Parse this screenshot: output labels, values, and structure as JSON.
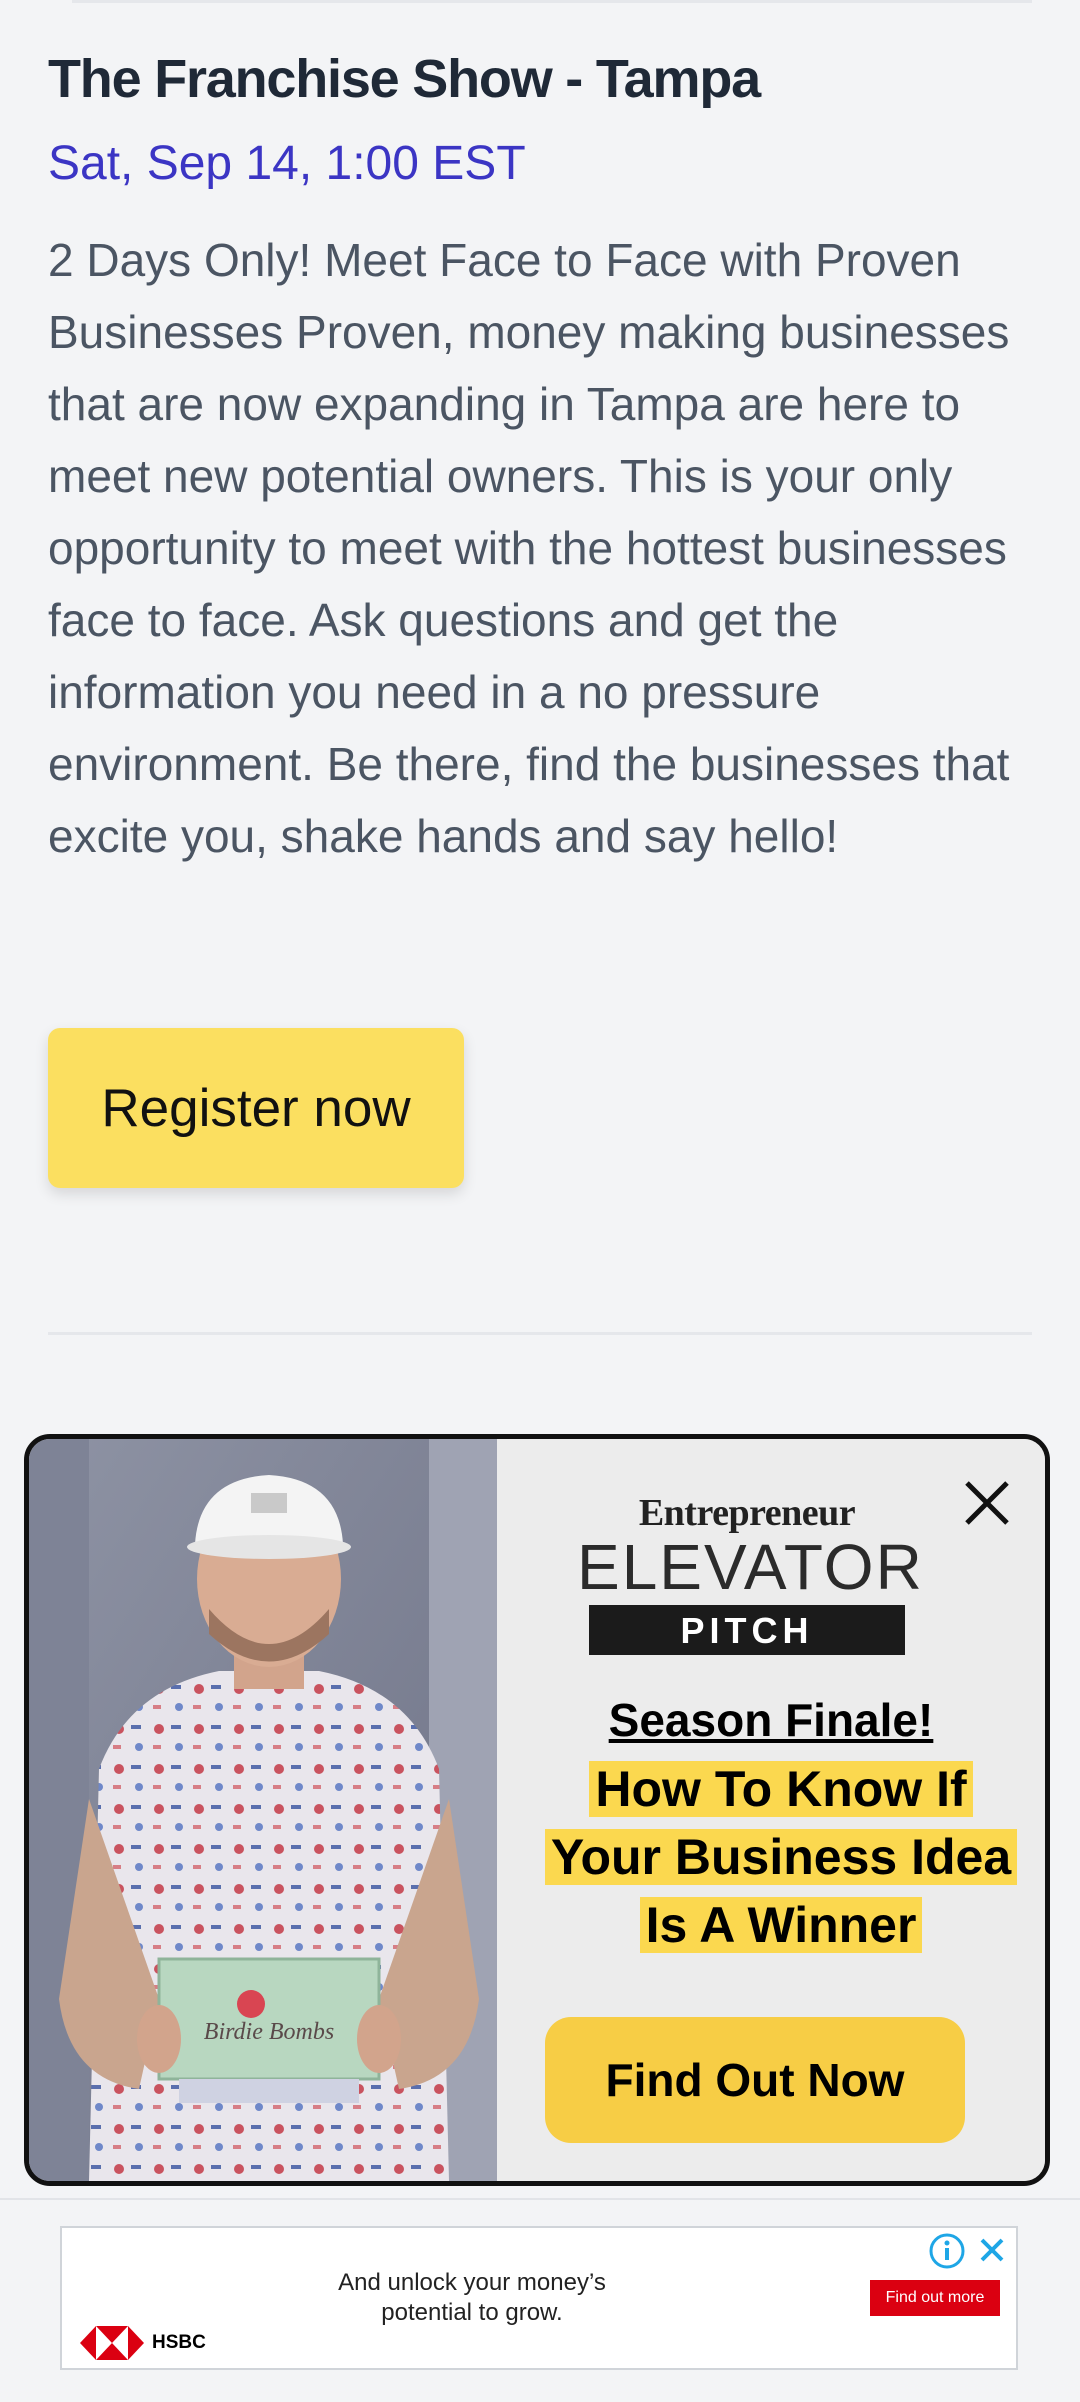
{
  "event": {
    "title": "The Franchise Show - Tampa",
    "date": "Sat, Sep 14, 1:00 EST",
    "description": "2 Days Only! Meet Face to Face with Proven Businesses Proven, money making businesses that are now expanding in Tampa are here to meet new potential owners. This is your only opportunity to meet with the hottest businesses face to face. Ask questions and get the information you need in a no pressure environment. Be there, find the businesses that excite you, shake hands and say hello!",
    "register_label": "Register now"
  },
  "ad": {
    "brand_top": "Entrepreneur",
    "brand_main": "ELEVATOR",
    "brand_sub": "PITCH",
    "kicker": "Season Finale!",
    "headline": "How To Know If Your Business Idea Is A Winner",
    "cta_label": "Find Out Now",
    "product_text": "Birdie Bombs"
  },
  "banner": {
    "text": "And unlock your money’s potential to grow.",
    "cta_label": "Find out more",
    "advertiser": "HSBC"
  },
  "colors": {
    "accent_date": "#3b35c4",
    "register_button": "#fbdf60",
    "cta_button": "#f7cd45",
    "highlight": "#fbd84f",
    "hsbc_red": "#db0011"
  }
}
